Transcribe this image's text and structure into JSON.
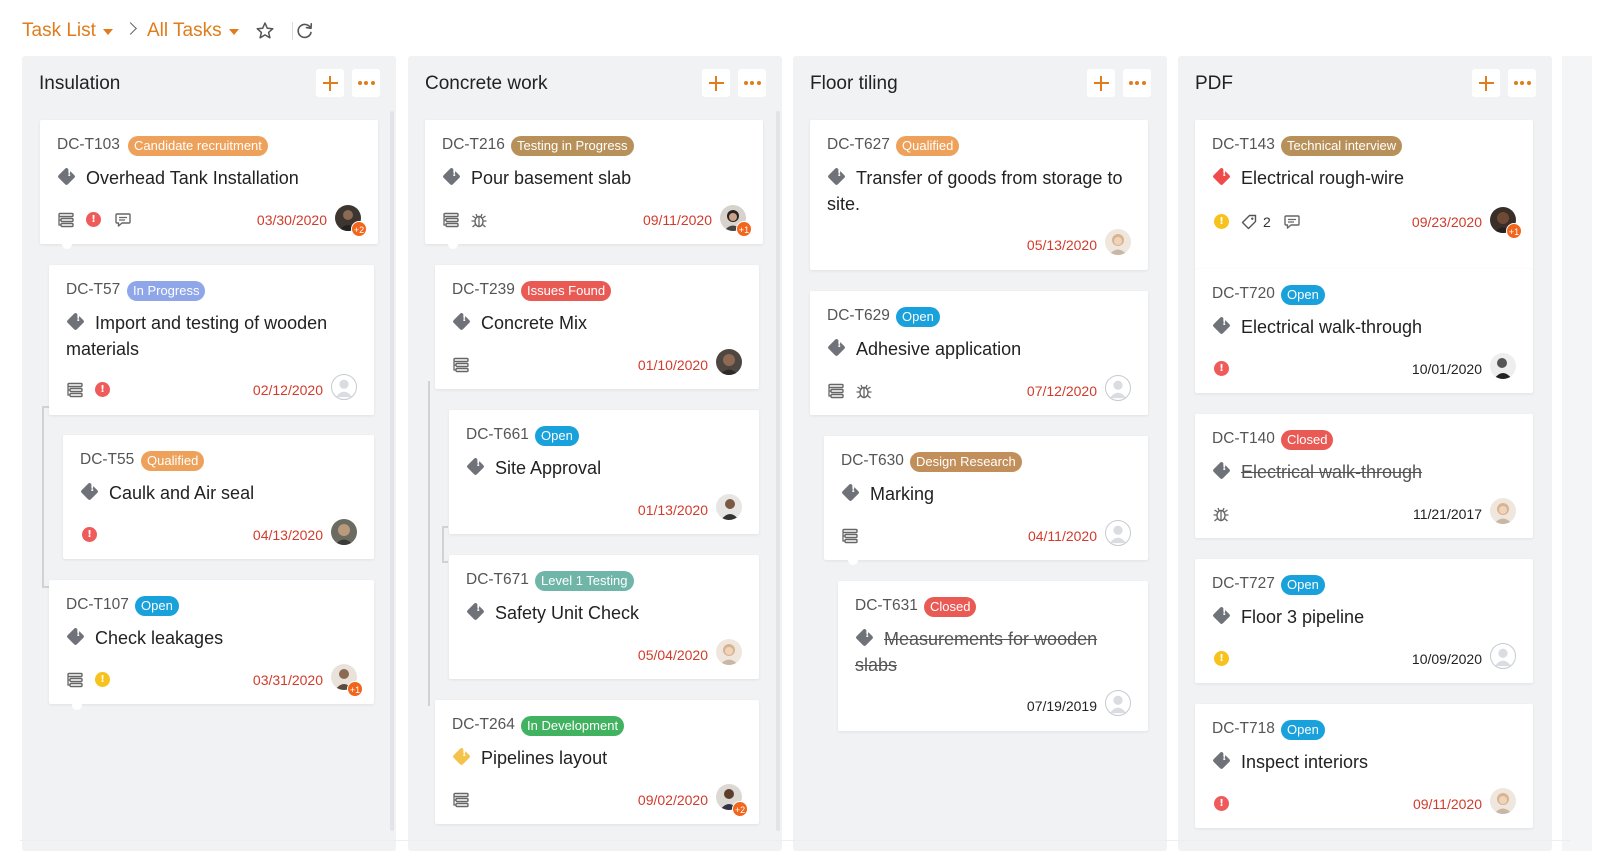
{
  "breadcrumb": {
    "list": "Task List",
    "view": "All Tasks"
  },
  "colors": {
    "accent": "#e07c1c",
    "date_due": "#d23b2c",
    "column_bg": "#f1f2f4"
  },
  "columns": [
    {
      "title": "Insulation",
      "cards": [
        {
          "id": "DC-T103",
          "tag": "Candidate recruitment",
          "title": "Overhead Tank Installation",
          "date": "03/30/2020",
          "badge": "+2"
        },
        {
          "id": "DC-T57",
          "tag": "In Progress",
          "title_l1": "Import and testing of wooden",
          "title_l2": "materials",
          "date": "02/12/2020"
        },
        {
          "id": "DC-T55",
          "tag": "Qualified",
          "title": "Caulk and Air seal",
          "date": "04/13/2020"
        },
        {
          "id": "DC-T107",
          "tag": "Open",
          "title": "Check leakages",
          "date": "03/31/2020",
          "badge": "+1"
        }
      ]
    },
    {
      "title": "Concrete work",
      "cards": [
        {
          "id": "DC-T216",
          "tag": "Testing in Progress",
          "title": "Pour basement slab",
          "date": "09/11/2020",
          "badge": "+1"
        },
        {
          "id": "DC-T239",
          "tag": "Issues Found",
          "title": "Concrete Mix",
          "date": "01/10/2020"
        },
        {
          "id": "DC-T661",
          "tag": "Open",
          "title": "Site Approval",
          "date": "01/13/2020"
        },
        {
          "id": "DC-T671",
          "tag": "Level 1 Testing",
          "title": "Safety Unit Check",
          "date": "05/04/2020"
        },
        {
          "id": "DC-T264",
          "tag": "In Development",
          "title": "Pipelines layout",
          "date": "09/02/2020",
          "badge": "+2"
        }
      ]
    },
    {
      "title": "Floor tiling",
      "cards": [
        {
          "id": "DC-T627",
          "tag": "Qualified",
          "title_l1": "Transfer of goods from storage to",
          "title_l2": "site.",
          "date": "05/13/2020"
        },
        {
          "id": "DC-T629",
          "tag": "Open",
          "title": "Adhesive application",
          "date": "07/12/2020"
        },
        {
          "id": "DC-T630",
          "tag": "Design Research",
          "title": "Marking",
          "date": "04/11/2020"
        },
        {
          "id": "DC-T631",
          "tag": "Closed",
          "title_l1": "Measurements for wooden",
          "title_l2": "slabs",
          "date": "07/19/2019"
        }
      ]
    },
    {
      "title": "PDF",
      "cards": [
        {
          "id": "DC-T143",
          "tag": "Technical interview",
          "title": "Electrical rough-wire",
          "date": "09/23/2020",
          "tag_count": "2",
          "badge": "+1"
        },
        {
          "id": "DC-T720",
          "tag": "Open",
          "title": "Electrical walk-through",
          "date": "10/01/2020"
        },
        {
          "id": "DC-T140",
          "tag": "Closed",
          "title": "Electrical walk-through",
          "date": "11/21/2017"
        },
        {
          "id": "DC-T727",
          "tag": "Open",
          "title": "Floor 3 pipeline",
          "date": "10/09/2020"
        },
        {
          "id": "DC-T718",
          "tag": "Open",
          "title": "Inspect interiors",
          "date": "09/11/2020"
        }
      ]
    }
  ]
}
